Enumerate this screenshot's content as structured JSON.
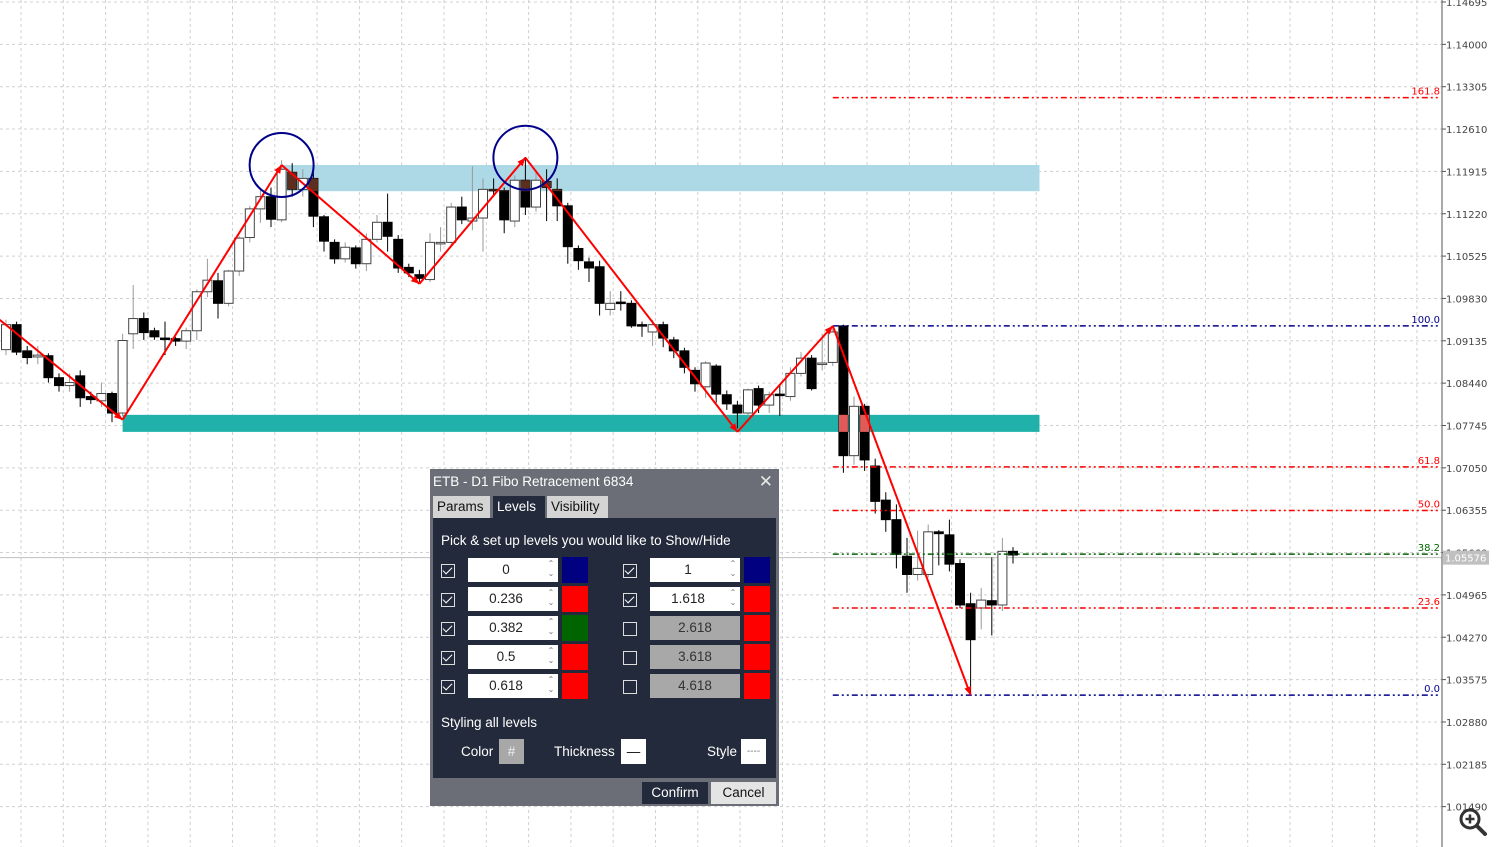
{
  "chart_data": {
    "type": "candlestick",
    "price_axis": {
      "ticks": [
        "1.14695",
        "1.14000",
        "1.13305",
        "1.12610",
        "1.11915",
        "1.11220",
        "1.10525",
        "1.09830",
        "1.09135",
        "1.08440",
        "1.07745",
        "1.07050",
        "1.06355",
        "1.05660",
        "1.04965",
        "1.04270",
        "1.03575",
        "1.02880",
        "1.02185",
        "1.01490"
      ],
      "max": 1.14695,
      "tick_step": 0.00695
    },
    "current_price": "1.05576",
    "grid": true,
    "candles": [
      [
        1.0899,
        1.0948,
        1.089,
        1.094
      ],
      [
        1.094,
        1.0945,
        1.089,
        1.0895
      ],
      [
        1.0897,
        1.0905,
        1.0875,
        1.0886
      ],
      [
        1.0887,
        1.0905,
        1.0875,
        1.089
      ],
      [
        1.0889,
        1.0893,
        1.0845,
        1.0853
      ],
      [
        1.0853,
        1.086,
        1.083,
        1.084
      ],
      [
        1.084,
        1.086,
        1.083,
        1.0845
      ],
      [
        1.0856,
        1.0865,
        1.0805,
        1.082
      ],
      [
        1.0822,
        1.083,
        1.081,
        1.0817
      ],
      [
        1.0815,
        1.0845,
        1.0805,
        1.0827
      ],
      [
        1.0827,
        1.083,
        1.078,
        1.0795
      ],
      [
        1.0795,
        1.0925,
        1.079,
        1.0914
      ],
      [
        1.0925,
        1.1005,
        1.09,
        1.095
      ],
      [
        1.095,
        1.096,
        1.0915,
        1.0927
      ],
      [
        1.093,
        1.0935,
        1.0915,
        1.092
      ],
      [
        1.0918,
        1.0945,
        1.089,
        1.0917
      ],
      [
        1.0917,
        1.092,
        1.0905,
        1.0913
      ],
      [
        1.0913,
        1.0935,
        1.09,
        1.093
      ],
      [
        1.093,
        1.0998,
        1.0915,
        1.0994
      ],
      [
        1.0994,
        1.1048,
        1.0985,
        1.1013
      ],
      [
        1.1012,
        1.1025,
        1.095,
        1.0975
      ],
      [
        1.0975,
        1.103,
        1.097,
        1.1028
      ],
      [
        1.1028,
        1.1085,
        1.102,
        1.1082
      ],
      [
        1.1083,
        1.1135,
        1.1075,
        1.113
      ],
      [
        1.113,
        1.1165,
        1.1107,
        1.115
      ],
      [
        1.115,
        1.1165,
        1.11,
        1.1113
      ],
      [
        1.1112,
        1.121,
        1.1108,
        1.1195
      ],
      [
        1.119,
        1.1205,
        1.115,
        1.1162
      ],
      [
        1.1162,
        1.1195,
        1.115,
        1.118
      ],
      [
        1.118,
        1.119,
        1.11,
        1.1118
      ],
      [
        1.1117,
        1.112,
        1.106,
        1.1077
      ],
      [
        1.1075,
        1.108,
        1.104,
        1.1048
      ],
      [
        1.1048,
        1.1075,
        1.1042,
        1.1067
      ],
      [
        1.1066,
        1.107,
        1.1032,
        1.104
      ],
      [
        1.104,
        1.109,
        1.1028,
        1.108
      ],
      [
        1.108,
        1.112,
        1.1075,
        1.1108
      ],
      [
        1.1108,
        1.1155,
        1.106,
        1.1085
      ],
      [
        1.108,
        1.1087,
        1.1025,
        1.1033
      ],
      [
        1.1034,
        1.104,
        1.1018,
        1.1025
      ],
      [
        1.1022,
        1.103,
        1.101,
        1.1016
      ],
      [
        1.1014,
        1.109,
        1.101,
        1.1075
      ],
      [
        1.1073,
        1.11,
        1.106,
        1.1075
      ],
      [
        1.1075,
        1.114,
        1.107,
        1.1133
      ],
      [
        1.1133,
        1.115,
        1.1105,
        1.1112
      ],
      [
        1.111,
        1.12,
        1.1095,
        1.1115
      ],
      [
        1.1115,
        1.118,
        1.106,
        1.1162
      ],
      [
        1.1162,
        1.118,
        1.115,
        1.116
      ],
      [
        1.116,
        1.1165,
        1.109,
        1.1112
      ],
      [
        1.111,
        1.1185,
        1.11,
        1.1177
      ],
      [
        1.1177,
        1.1215,
        1.112,
        1.1133
      ],
      [
        1.1133,
        1.119,
        1.1125,
        1.1177
      ],
      [
        1.1175,
        1.1195,
        1.111,
        1.1165
      ],
      [
        1.1162,
        1.118,
        1.111,
        1.1135
      ],
      [
        1.1135,
        1.114,
        1.104,
        1.1068
      ],
      [
        1.1065,
        1.107,
        1.103,
        1.1045
      ],
      [
        1.1043,
        1.105,
        1.101,
        1.1033
      ],
      [
        1.1035,
        1.1045,
        1.0955,
        1.0975
      ],
      [
        1.0965,
        1.0995,
        1.0955,
        1.0975
      ],
      [
        1.0977,
        1.0995,
        1.0963,
        1.0975
      ],
      [
        1.0975,
        1.098,
        1.0935,
        1.0938
      ],
      [
        1.094,
        1.0945,
        1.092,
        1.0938
      ],
      [
        1.0928,
        1.0948,
        1.0905,
        1.094
      ],
      [
        1.094,
        1.0945,
        1.0903,
        1.0918
      ],
      [
        1.0915,
        1.092,
        1.0885,
        1.0897
      ],
      [
        1.0897,
        1.0902,
        1.086,
        1.087
      ],
      [
        1.0865,
        1.087,
        1.083,
        1.0843
      ],
      [
        1.0838,
        1.088,
        1.082,
        1.0877
      ],
      [
        1.0872,
        1.0875,
        1.0812,
        1.0826
      ],
      [
        1.0825,
        1.0832,
        1.08,
        1.081
      ],
      [
        1.0808,
        1.0815,
        1.077,
        1.0795
      ],
      [
        1.0795,
        1.0835,
        1.079,
        1.0833
      ],
      [
        1.0835,
        1.084,
        1.0795,
        1.0808
      ],
      [
        1.0808,
        1.083,
        1.0795,
        1.0825
      ],
      [
        1.0826,
        1.0842,
        1.079,
        1.0825
      ],
      [
        1.0822,
        1.087,
        1.0815,
        1.086
      ],
      [
        1.086,
        1.0895,
        1.0855,
        1.0885
      ],
      [
        1.0885,
        1.089,
        1.0832,
        1.0835
      ],
      [
        1.0877,
        1.0925,
        1.0865,
        1.0877
      ],
      [
        1.0878,
        1.0935,
        1.0872,
        1.0928
      ],
      [
        1.0938,
        1.094,
        1.0697,
        1.0725
      ],
      [
        1.0725,
        1.0822,
        1.071,
        1.0806
      ],
      [
        1.0806,
        1.081,
        1.07,
        1.0718
      ],
      [
        1.0708,
        1.072,
        1.063,
        1.065
      ],
      [
        1.0652,
        1.0665,
        1.06,
        1.062
      ],
      [
        1.062,
        1.0645,
        1.054,
        1.0563
      ],
      [
        1.056,
        1.059,
        1.05,
        1.053
      ],
      [
        1.053,
        1.0602,
        1.052,
        1.054
      ],
      [
        1.053,
        1.0612,
        1.0525,
        1.06
      ],
      [
        1.06,
        1.0603,
        1.0545,
        1.0597
      ],
      [
        1.0595,
        1.062,
        1.0535,
        1.0547
      ],
      [
        1.0548,
        1.0555,
        1.0475,
        1.048
      ],
      [
        1.0482,
        1.05,
        1.0332,
        1.0423
      ],
      [
        1.0475,
        1.0508,
        1.044,
        1.0488
      ],
      [
        1.0487,
        1.0558,
        1.043,
        1.048
      ],
      [
        1.048,
        1.059,
        1.047,
        1.0568
      ],
      [
        1.0568,
        1.0575,
        1.0548,
        1.0562
      ]
    ],
    "zigzag": [
      [
        -0.6,
        1.0948
      ],
      [
        11,
        1.0784
      ],
      [
        26,
        1.1202
      ],
      [
        39,
        1.1007
      ],
      [
        49,
        1.1214
      ],
      [
        69,
        1.0764
      ],
      [
        78,
        1.0938
      ],
      [
        91,
        1.0332
      ]
    ],
    "highlight_circles_at_index": [
      26,
      49
    ],
    "zones": [
      {
        "from_index": 26,
        "to_index": 97.5,
        "top": 1.1202,
        "bottom": 1.1159,
        "color": "#add8e6",
        "overlap_color": "#5c2e1e"
      },
      {
        "from_index": 11,
        "to_index": 97.5,
        "top": 1.0792,
        "bottom": 1.0764,
        "color": "#20b2aa",
        "overlap_color": "#e05a5a"
      }
    ],
    "fibo": {
      "from_index": 78,
      "low": 1.0332,
      "high": 1.0938,
      "levels": [
        {
          "label": "161.8",
          "ratio": 1.618,
          "color": "#ff0000"
        },
        {
          "label": "100.0",
          "ratio": 1.0,
          "color": "#00008b"
        },
        {
          "label": "61.8",
          "ratio": 0.618,
          "color": "#ff0000"
        },
        {
          "label": "50.0",
          "ratio": 0.5,
          "color": "#ff0000"
        },
        {
          "label": "38.2",
          "ratio": 0.382,
          "color": "#006400"
        },
        {
          "label": "23.6",
          "ratio": 0.236,
          "color": "#ff0000"
        },
        {
          "label": "0.0",
          "ratio": 0.0,
          "color": "#00008b"
        }
      ]
    },
    "colors": {
      "zigzag": "#ff0000",
      "circle": "#00008b",
      "bull": "#ffffff",
      "bear": "#000000"
    }
  },
  "toolbar": {
    "zoom_icon": "magnifier-plus-icon"
  },
  "dialog": {
    "title": "ETB - D1 Fibo Retracement 6834",
    "close_icon": "close-icon",
    "tabs": [
      {
        "label": "Params",
        "active": false
      },
      {
        "label": "Levels",
        "active": true
      },
      {
        "label": "Visibility",
        "active": false
      }
    ],
    "hint": "Pick & set up levels you would like to Show/Hide",
    "levels_left": [
      {
        "value": "0",
        "checked": true,
        "color": "#000080"
      },
      {
        "value": "0.236",
        "checked": true,
        "color": "#ff0000"
      },
      {
        "value": "0.382",
        "checked": true,
        "color": "#006400"
      },
      {
        "value": "0.5",
        "checked": true,
        "color": "#ff0000"
      },
      {
        "value": "0.618",
        "checked": true,
        "color": "#ff0000"
      }
    ],
    "levels_right": [
      {
        "value": "1",
        "checked": true,
        "color": "#000080"
      },
      {
        "value": "1.618",
        "checked": true,
        "color": "#ff0000"
      },
      {
        "value": "2.618",
        "checked": false,
        "color": "#ff0000"
      },
      {
        "value": "3.618",
        "checked": false,
        "color": "#ff0000"
      },
      {
        "value": "4.618",
        "checked": false,
        "color": "#ff0000"
      }
    ],
    "styling_title": "Styling all levels",
    "color_label": "Color",
    "color_button": "#",
    "thickness_label": "Thickness",
    "thickness_button": "—",
    "style_label": "Style",
    "style_button": "----",
    "confirm": "Confirm",
    "cancel": "Cancel"
  }
}
